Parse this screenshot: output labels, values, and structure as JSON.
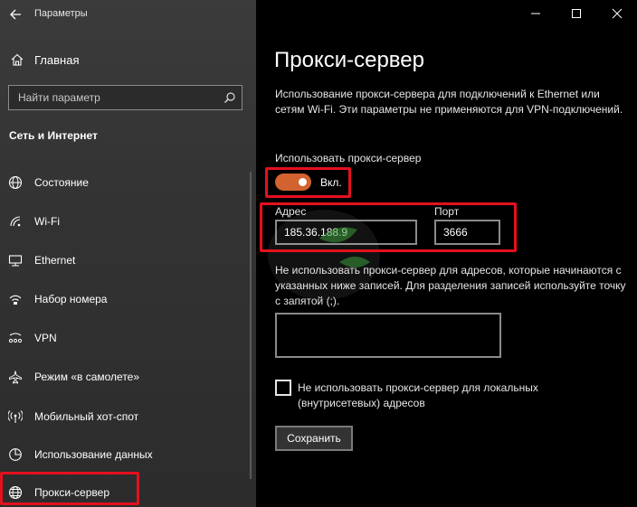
{
  "window": {
    "title": "Параметры",
    "controls": [
      "minimize-icon",
      "maximize-icon",
      "close-icon"
    ]
  },
  "sidebar": {
    "home_label": "Главная",
    "search": {
      "placeholder": "Найти параметр",
      "value": ""
    },
    "section_title": "Сеть и Интернет",
    "items": [
      {
        "label": "Состояние",
        "icon": "globe-status-icon"
      },
      {
        "label": "Wi-Fi",
        "icon": "wifi-icon"
      },
      {
        "label": "Ethernet",
        "icon": "ethernet-icon"
      },
      {
        "label": "Набор номера",
        "icon": "dialup-icon"
      },
      {
        "label": "VPN",
        "icon": "vpn-icon"
      },
      {
        "label": "Режим «в самолете»",
        "icon": "airplane-icon"
      },
      {
        "label": "Мобильный хот-спот",
        "icon": "hotspot-icon"
      },
      {
        "label": "Использование данных",
        "icon": "data-usage-icon"
      },
      {
        "label": "Прокси-сервер",
        "icon": "proxy-globe-icon",
        "active": true
      }
    ]
  },
  "main": {
    "title": "Прокси-сервер",
    "description": "Использование прокси-сервера для подключений к Ethernet или сетям Wi-Fi. Эти параметры не применяются для VPN-подключений.",
    "use_proxy_label": "Использовать прокси-сервер",
    "toggle_state": "Вкл.",
    "toggle_on": true,
    "address_label": "Адрес",
    "address_value": "185.36.188.9",
    "port_label": "Порт",
    "port_value": "3666",
    "exclusions_description": "Не использовать прокси-сервер для адресов, которые начинаются с указанных ниже записей. Для разделения записей используйте точку с запятой (;).",
    "exclusions_value": "",
    "local_checkbox_label": "Не использовать прокси-сервер для локальных (внутрисетевых) адресов",
    "local_checkbox_checked": false,
    "save_label": "Сохранить"
  },
  "colors": {
    "accent_toggle": "#d2622f",
    "highlight": "#e5101d"
  }
}
